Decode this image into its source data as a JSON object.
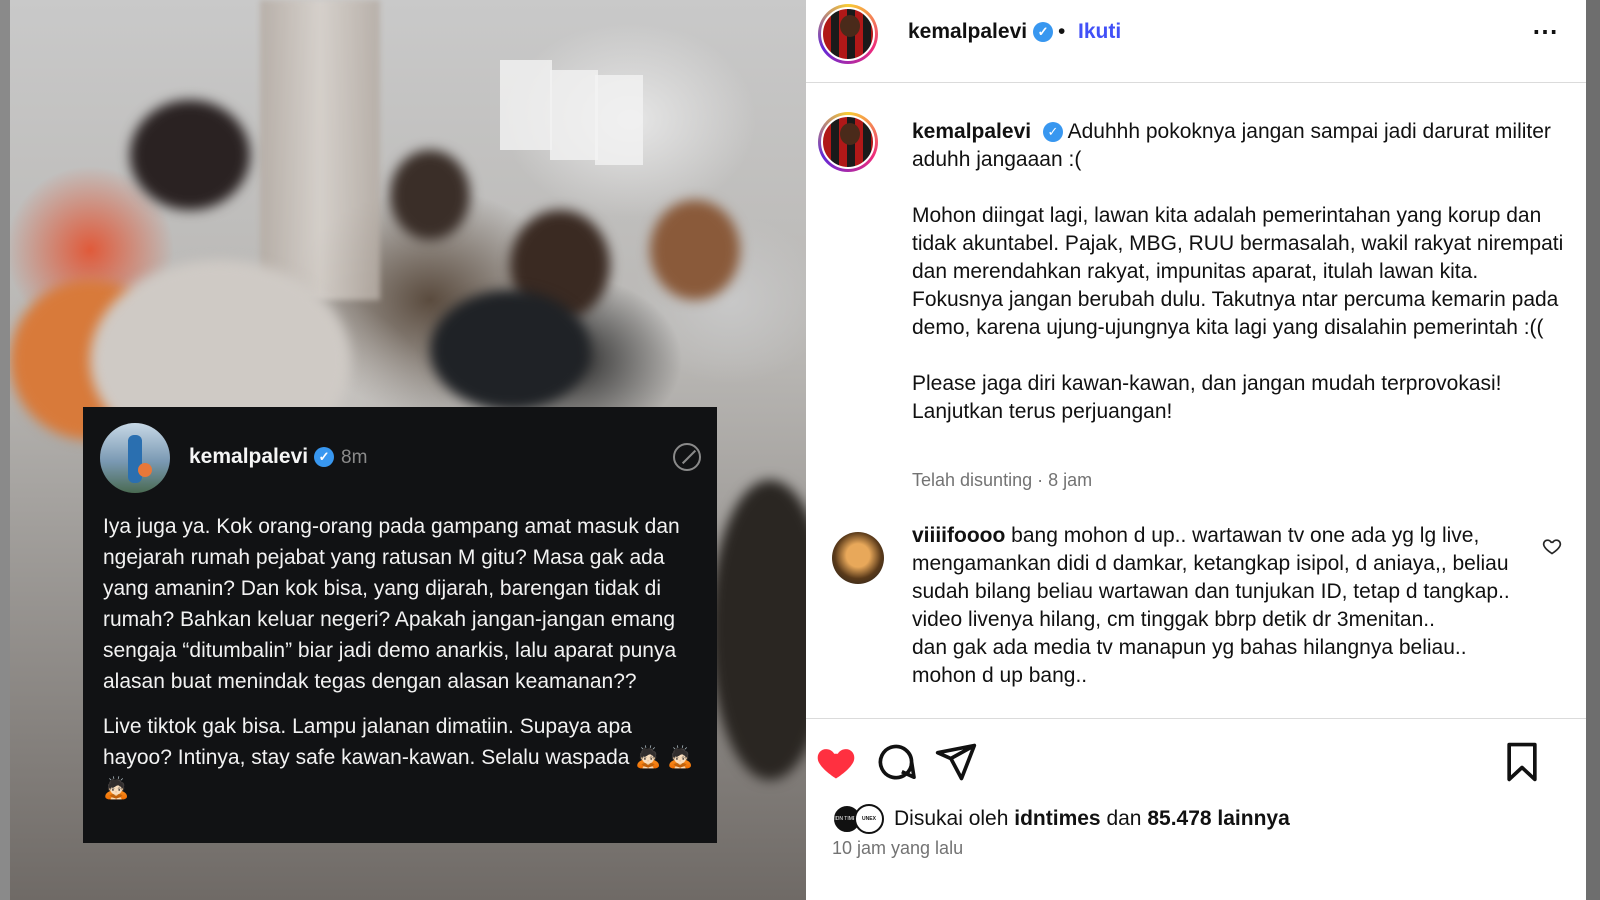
{
  "header": {
    "username": "kemalpalevi",
    "separator": "•",
    "follow_label": "Ikuti",
    "more_icon": "⋯"
  },
  "threads_card": {
    "username": "kemalpalevi",
    "time": "8m",
    "paragraphs": [
      "Iya juga ya. Kok orang-orang pada gampang amat masuk dan ngejarah rumah pejabat yang ratusan M gitu? Masa gak ada yang amanin? Dan kok bisa, yang dijarah, barengan tidak di rumah? Bahkan keluar negeri? Apakah jangan-jangan emang sengaja “ditumbalin” biar jadi demo anarkis, lalu aparat punya alasan buat menindak tegas dengan alasan keamanan??",
      "Live tiktok gak bisa. Lampu jalanan dimatiin. Supaya apa hayoo? Intinya, stay safe kawan-kawan. Selalu waspada 🙇🏻 🙇🏻 🙇🏻"
    ]
  },
  "caption": {
    "username": "kemalpalevi",
    "paragraphs": [
      "Aduhhh pokoknya jangan sampai jadi darurat militer aduhh jangaaan :(",
      "Mohon diingat lagi, lawan kita adalah pemerintahan yang korup dan tidak akuntabel. Pajak, MBG, RUU bermasalah, wakil rakyat nirempati dan merendahkan rakyat, impunitas aparat, itulah lawan kita. Fokusnya jangan berubah dulu. Takutnya ntar percuma kemarin pada demo, karena ujung-ujungnya kita lagi yang disalahin pemerintah :((",
      "Please jaga diri kawan-kawan, dan jangan mudah terprovokasi! Lanjutkan terus perjuangan!"
    ],
    "meta": "Telah disunting · 8 jam"
  },
  "comment": {
    "username": "viiiifoooo",
    "text_first": "bang mohon d up.. wartawan tv one ada yg lg live, mengamankan didi d damkar, ketangkap isipol, d aniaya,, beliau sudah bilang beliau wartawan dan tunjukan ID, tetap d tangkap..",
    "text_lines": [
      "video livenya hilang, cm tinggak bbrp detik dr 3menitan..",
      "dan gak ada media tv manapun yg bahas hilangnya beliau..",
      "mohon d up bang.."
    ]
  },
  "likes": {
    "prefix": "Disukai oleh",
    "user": "idntimes",
    "conj": "dan",
    "count": "85.478 lainnya",
    "av1_text": "IDN TIMES",
    "av2_text": "UNEX PLND"
  },
  "time_ago": "10 jam yang lalu",
  "colors": {
    "link": "#4150f7",
    "heart": "#ff3040",
    "verified": "#3897f0"
  }
}
